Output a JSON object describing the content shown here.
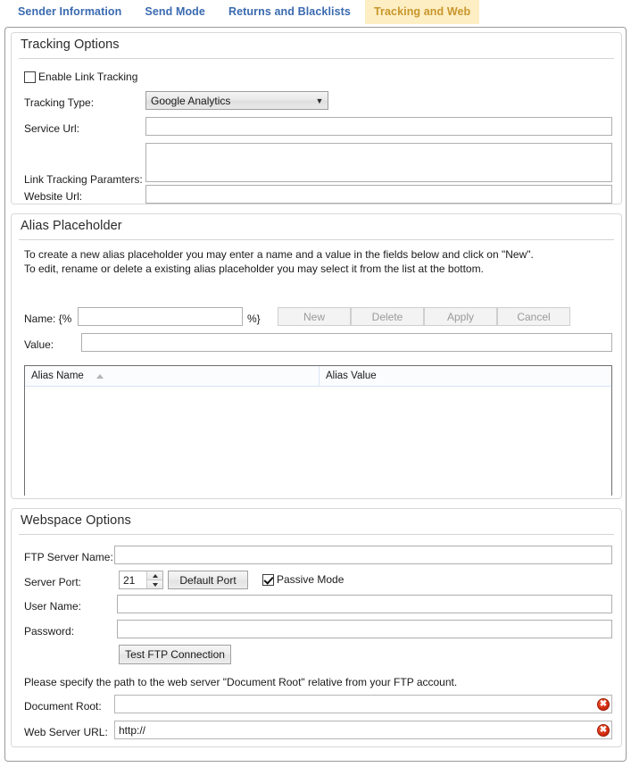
{
  "tabs": [
    {
      "label": "Sender Information",
      "active": false
    },
    {
      "label": "Send Mode",
      "active": false
    },
    {
      "label": "Returns and Blacklists",
      "active": false
    },
    {
      "label": "Tracking and Web",
      "active": true
    }
  ],
  "colors": {
    "tab_inactive_text": "#3a6ab0",
    "tab_active_text": "#c8962c",
    "tab_active_bg": "#fdeec3",
    "error_badge": "#d32b10",
    "frame_border": "#9a9a9a"
  },
  "tracking_options": {
    "title": "Tracking Options",
    "enable_link_tracking": {
      "label": "Enable Link Tracking",
      "checked": false
    },
    "tracking_type": {
      "label": "Tracking Type:",
      "value": "Google Analytics",
      "arrow": "chevron-down-icon"
    },
    "service_url": {
      "label": "Service Url:",
      "value": ""
    },
    "link_tracking_parameters": {
      "label": "Link Tracking Paramters:",
      "value": ""
    },
    "website_url": {
      "label": "Website Url:",
      "value": ""
    }
  },
  "alias_placeholder": {
    "title": "Alias Placeholder",
    "description_line1": "To create a new alias placeholder you may enter a name and a value in the fields below and click on \"New\".",
    "description_line2": "To edit, rename or delete a existing alias placeholder you may select it from the list at the bottom.",
    "name_label": "Name: {%",
    "name_suffix": "%}",
    "name_value": "",
    "value_label": "Value:",
    "value_value": "",
    "buttons": [
      {
        "label": "New",
        "disabled": true
      },
      {
        "label": "Delete",
        "disabled": true
      },
      {
        "label": "Apply",
        "disabled": true
      },
      {
        "label": "Cancel",
        "disabled": true
      }
    ],
    "grid": {
      "columns": [
        "Alias Name",
        "Alias Value"
      ],
      "sort_column": "Alias Name",
      "sort_direction": "ascending",
      "rows": []
    }
  },
  "webspace_options": {
    "title": "Webspace Options",
    "ftp_server_name": {
      "label": "FTP Server Name:",
      "value": ""
    },
    "server_port": {
      "label": "Server Port:",
      "value": "21"
    },
    "default_port_button": "Default Port",
    "passive_mode": {
      "label": "Passive Mode",
      "checked": true
    },
    "user_name": {
      "label": "User Name:",
      "value": ""
    },
    "password": {
      "label": "Password:",
      "value": ""
    },
    "test_ftp_button": "Test FTP Connection",
    "note": "Please specify the path to the web server \"Document Root\" relative from your FTP account.",
    "document_root": {
      "label": "Document Root:",
      "value": "",
      "error": true,
      "error_glyph": "✖"
    },
    "web_server_url": {
      "label": "Web Server URL:",
      "value": "http://",
      "error": true,
      "error_glyph": "✖"
    }
  }
}
